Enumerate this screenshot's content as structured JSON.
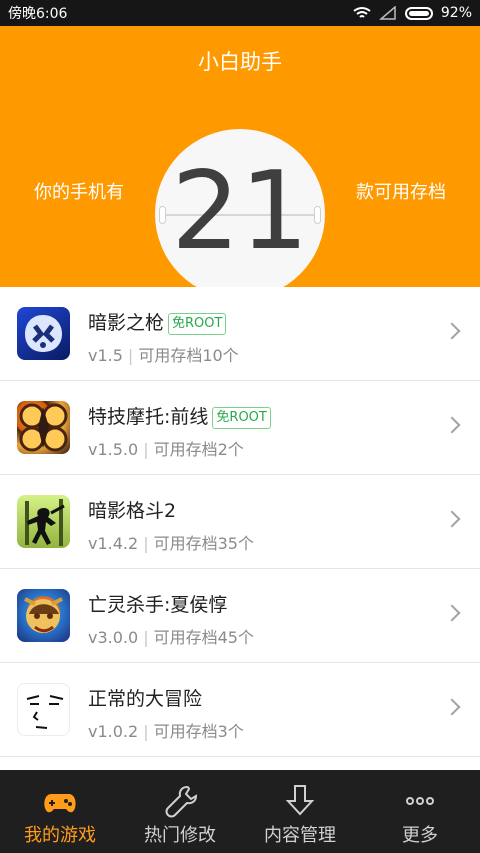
{
  "status_bar": {
    "time": "傍晚6:06",
    "battery_percent": "92%",
    "battery_level": 0.92
  },
  "header": {
    "title": "小白助手",
    "left_text": "你的手机有",
    "count": "21",
    "right_text": "款可用存档"
  },
  "games": [
    {
      "name": "暗影之枪",
      "badge": "免ROOT",
      "version": "v1.5",
      "saves": "可用存档10个",
      "icon": "shadow-gun-icon"
    },
    {
      "name": "特技摩托:前线",
      "badge": "免ROOT",
      "version": "v1.5.0",
      "saves": "可用存档2个",
      "icon": "trials-frontier-icon"
    },
    {
      "name": "暗影格斗2",
      "badge": "",
      "version": "v1.4.2",
      "saves": "可用存档35个",
      "icon": "shadow-fight-icon"
    },
    {
      "name": "亡灵杀手:夏侯惇",
      "badge": "",
      "version": "v3.0.0",
      "saves": "可用存档45个",
      "icon": "undead-slayer-icon"
    },
    {
      "name": "正常的大冒险",
      "badge": "",
      "version": "v1.0.2",
      "saves": "可用存档3个",
      "icon": "normal-adventure-icon"
    }
  ],
  "nav": [
    {
      "label": "我的游戏",
      "icon": "gamepad-icon"
    },
    {
      "label": "热门修改",
      "icon": "wrench-icon"
    },
    {
      "label": "内容管理",
      "icon": "download-icon"
    },
    {
      "label": "更多",
      "icon": "more-icon"
    }
  ],
  "colors": {
    "accent": "#ff9900",
    "active_nav": "#ff9d1a",
    "root_badge": "#27a84b"
  }
}
